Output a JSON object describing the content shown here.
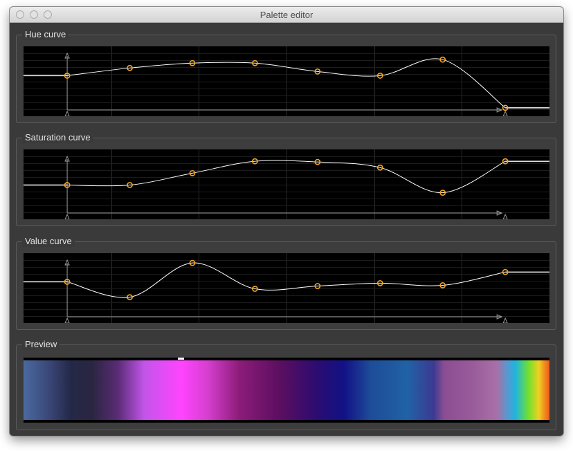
{
  "window": {
    "title": "Palette editor"
  },
  "curves": [
    {
      "id": "hue",
      "label": "Hue curve",
      "points": [
        [
          0.083,
          0.42
        ],
        [
          0.202,
          0.31
        ],
        [
          0.321,
          0.24
        ],
        [
          0.44,
          0.24
        ],
        [
          0.559,
          0.36
        ],
        [
          0.678,
          0.42
        ],
        [
          0.797,
          0.19
        ],
        [
          0.916,
          0.88
        ]
      ],
      "line_start_y": 0.42,
      "line_end_y": 0.88
    },
    {
      "id": "saturation",
      "label": "Saturation curve",
      "points": [
        [
          0.083,
          0.51
        ],
        [
          0.202,
          0.51
        ],
        [
          0.321,
          0.34
        ],
        [
          0.44,
          0.17
        ],
        [
          0.559,
          0.18
        ],
        [
          0.678,
          0.26
        ],
        [
          0.797,
          0.62
        ],
        [
          0.916,
          0.17
        ]
      ],
      "line_start_y": 0.51,
      "line_end_y": 0.17
    },
    {
      "id": "value",
      "label": "Value curve",
      "points": [
        [
          0.083,
          0.41
        ],
        [
          0.202,
          0.63
        ],
        [
          0.321,
          0.14
        ],
        [
          0.44,
          0.51
        ],
        [
          0.559,
          0.47
        ],
        [
          0.678,
          0.43
        ],
        [
          0.797,
          0.46
        ],
        [
          0.916,
          0.27
        ]
      ],
      "line_start_y": 0.41,
      "line_end_y": 0.27
    }
  ],
  "preview": {
    "label": "Preview"
  },
  "colors": {
    "window_bg": "#3a3a3a",
    "plot_bg": "#000000",
    "curve": "#ffffff",
    "control_point": "#f5a623",
    "axis": "#9a9a9a"
  }
}
